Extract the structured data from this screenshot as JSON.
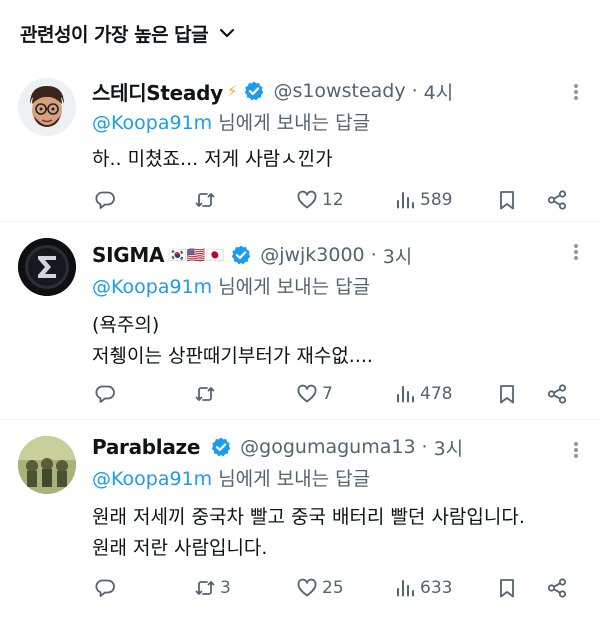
{
  "sort": {
    "label": "관련성이 가장 높은 답글"
  },
  "tweets": [
    {
      "name": "스테디Steady",
      "extra": "⚡",
      "handle": "@s1owsteady",
      "dot": "·",
      "time": "4시",
      "reply_to": "@Koopa91m",
      "reply_suffix": " 님에게 보내는 답글",
      "lines": [
        "하.. 미쳤죠... 저게 사람ㅅ낀가"
      ],
      "replies": "",
      "retweets": "",
      "likes": "12",
      "views": "589"
    },
    {
      "name": "SIGMA",
      "extra": "🇰🇷🇺🇸🇯🇵",
      "handle": "@jwjk3000",
      "dot": "·",
      "time": "3시",
      "reply_to": "@Koopa91m",
      "reply_suffix": " 님에게 보내는 답글",
      "lines": [
        "(욕주의)",
        "저췡이는 상판때기부터가 재수없...."
      ],
      "replies": "",
      "retweets": "",
      "likes": "7",
      "views": "478"
    },
    {
      "name": "Parablaze",
      "extra": "",
      "handle": "@gogumaguma13",
      "dot": "·",
      "time": "3시",
      "reply_to": "@Koopa91m",
      "reply_suffix": " 님에게 보내는 답글",
      "lines": [
        "원래 저세끼 중국차 빨고 중국 배터리 빨던 사람입니다.",
        "원래 저란 사람입니다."
      ],
      "replies": "",
      "retweets": "3",
      "likes": "25",
      "views": "633"
    }
  ],
  "icons": {
    "sort": "chevron-down-icon",
    "verified": "verified-badge-icon",
    "more": "more-dots-icon",
    "reply": "reply-bubble-icon",
    "retweet": "retweet-icon",
    "like": "heart-icon",
    "views": "views-bar-chart-icon",
    "bookmark": "bookmark-icon",
    "share": "share-icon"
  },
  "colors": {
    "accent": "#1d9bf0",
    "muted": "#536471",
    "text": "#0f1419",
    "divider": "#eff3f4"
  }
}
